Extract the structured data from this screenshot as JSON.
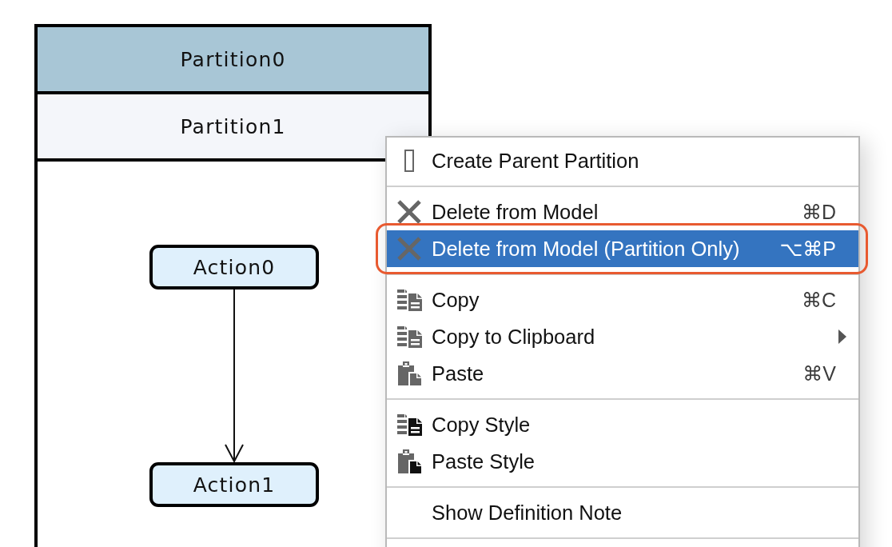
{
  "diagram": {
    "partitions": [
      {
        "label": "Partition0",
        "selected": true
      },
      {
        "label": "Partition1",
        "selected": false
      }
    ],
    "actions": [
      {
        "label": "Action0"
      },
      {
        "label": "Action1"
      }
    ]
  },
  "context_menu": {
    "sections": [
      {
        "items": [
          {
            "kind": "partition",
            "label": "Create Parent Partition",
            "selected": false,
            "outlined": false,
            "submenu": false
          }
        ]
      },
      {
        "items": [
          {
            "kind": "delete",
            "label": "Delete from Model",
            "shortcut": "⌘D",
            "selected": false,
            "outlined": false,
            "submenu": false
          },
          {
            "kind": "delete",
            "label": "Delete from Model (Partition Only)",
            "shortcut": "⌥⌘P",
            "selected": true,
            "outlined": true,
            "submenu": false
          }
        ]
      },
      {
        "items": [
          {
            "kind": "copy",
            "label": "Copy",
            "shortcut": "⌘C",
            "selected": false,
            "outlined": false,
            "submenu": false
          },
          {
            "kind": "copy",
            "label": "Copy to Clipboard",
            "selected": false,
            "outlined": false,
            "submenu": true
          },
          {
            "kind": "paste",
            "label": "Paste",
            "shortcut": "⌘V",
            "selected": false,
            "outlined": false,
            "submenu": false
          }
        ]
      },
      {
        "items": [
          {
            "kind": "copystyle",
            "label": "Copy Style",
            "selected": false,
            "outlined": false,
            "submenu": false
          },
          {
            "kind": "pastestyle",
            "label": "Paste Style",
            "selected": false,
            "outlined": false,
            "submenu": false
          }
        ]
      },
      {
        "items": [
          {
            "kind": "plain",
            "label": "Show Definition Note",
            "selected": false,
            "outlined": false,
            "submenu": false
          }
        ]
      }
    ]
  }
}
